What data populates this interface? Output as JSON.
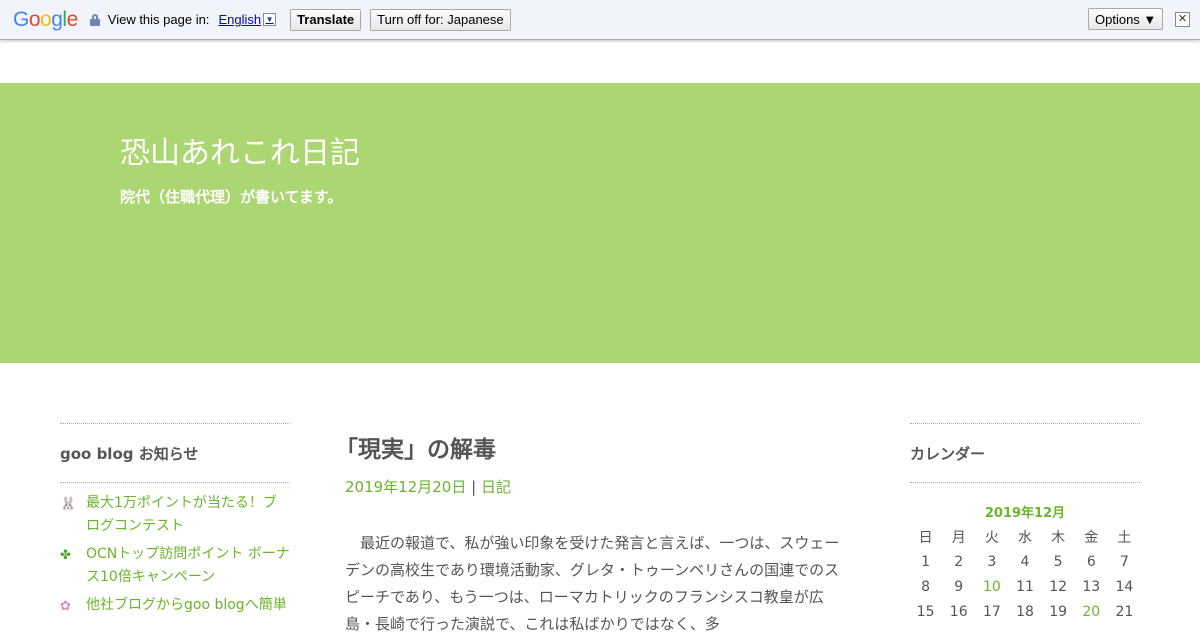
{
  "translate_bar": {
    "logo_letters": [
      {
        "ch": "G",
        "color": "#4285f4"
      },
      {
        "ch": "o",
        "color": "#ea4335"
      },
      {
        "ch": "o",
        "color": "#fbbc05"
      },
      {
        "ch": "g",
        "color": "#4285f4"
      },
      {
        "ch": "l",
        "color": "#34a853"
      },
      {
        "ch": "e",
        "color": "#ea4335"
      }
    ],
    "view_in_label": "View this page in:",
    "language": "English",
    "dropdown_glyph": "▼",
    "translate_label": "Translate",
    "turn_off_label": "Turn off for: Japanese",
    "options_label": "Options ▼",
    "close_glyph": "✕"
  },
  "header": {
    "title": "恐山あれこれ日記",
    "description": "院代（住職代理）が書いてます。"
  },
  "left_sidebar": {
    "heading": "goo blog お知らせ",
    "items": [
      {
        "icon": "rabbit-icon",
        "glyph": "🐰",
        "text": "最大1万ポイントが当たる！ブログコンテスト"
      },
      {
        "icon": "clover-icon",
        "glyph": "✤",
        "text": "OCNトップ訪問ポイント ボーナス10倍キャンペーン"
      },
      {
        "icon": "flower-icon",
        "glyph": "✿",
        "text": "他社ブログからgoo blogへ簡単"
      }
    ]
  },
  "post": {
    "title": "「現実」の解毒",
    "date": "2019年12月20日",
    "separator": "|",
    "category": "日記",
    "body": "最近の報道で、私が強い印象を受けた発言と言えば、一つは、スウェーデンの高校生であり環境活動家、グレタ・トゥーンベリさんの国連でのスピーチであり、もう一つは、ローマカトリックのフランシスコ教皇が広島・長崎で行った演説で、これは私ばかりではなく、多"
  },
  "right_sidebar": {
    "heading": "カレンダー",
    "month": "2019年12月",
    "weekdays": [
      "日",
      "月",
      "火",
      "水",
      "木",
      "金",
      "土"
    ],
    "weeks": [
      [
        "1",
        "2",
        "3",
        "4",
        "5",
        "6",
        "7"
      ],
      [
        "8",
        "9",
        "10",
        "11",
        "12",
        "13",
        "14"
      ],
      [
        "15",
        "16",
        "17",
        "18",
        "19",
        "20",
        "21"
      ]
    ],
    "linked_days": [
      "10",
      "20"
    ]
  },
  "colors": {
    "header_bg": "#acd671",
    "accent_green": "#6bb52c"
  }
}
